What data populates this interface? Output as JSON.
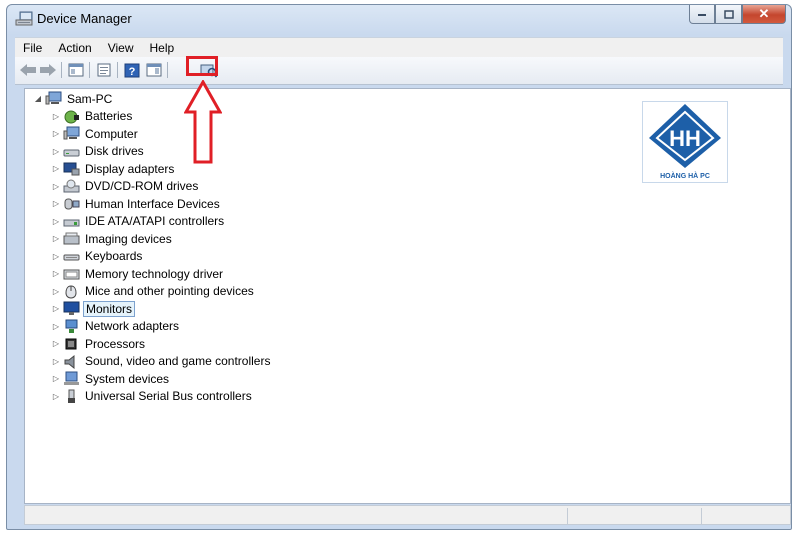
{
  "window": {
    "title": "Device Manager"
  },
  "controls": {
    "minimize": "–",
    "maximize": "□",
    "close": "✕"
  },
  "menu": [
    {
      "label": "File"
    },
    {
      "label": "Action"
    },
    {
      "label": "View"
    },
    {
      "label": "Help"
    }
  ],
  "tree": {
    "root": "Sam-PC",
    "root_expander": "◢",
    "items": [
      {
        "label": "Batteries",
        "icon": "battery-icon"
      },
      {
        "label": "Computer",
        "icon": "computer-icon"
      },
      {
        "label": "Disk drives",
        "icon": "disk-drive-icon"
      },
      {
        "label": "Display adapters",
        "icon": "display-adapter-icon"
      },
      {
        "label": "DVD/CD-ROM drives",
        "icon": "dvd-drive-icon"
      },
      {
        "label": "Human Interface Devices",
        "icon": "hid-icon"
      },
      {
        "label": "IDE ATA/ATAPI controllers",
        "icon": "ide-controller-icon"
      },
      {
        "label": "Imaging devices",
        "icon": "imaging-device-icon"
      },
      {
        "label": "Keyboards",
        "icon": "keyboard-icon"
      },
      {
        "label": "Memory technology driver",
        "icon": "memory-driver-icon"
      },
      {
        "label": "Mice and other pointing devices",
        "icon": "mouse-icon"
      },
      {
        "label": "Monitors",
        "icon": "monitor-icon",
        "selected": true
      },
      {
        "label": "Network adapters",
        "icon": "network-adapter-icon"
      },
      {
        "label": "Processors",
        "icon": "processor-icon"
      },
      {
        "label": "Sound, video and game controllers",
        "icon": "sound-icon"
      },
      {
        "label": "System devices",
        "icon": "system-device-icon"
      },
      {
        "label": "Universal Serial Bus controllers",
        "icon": "usb-icon"
      }
    ],
    "collapsed_expander": "▷"
  },
  "watermark": {
    "logo_letters": "HH",
    "text": "HOÀNG HÀ PC"
  },
  "colors": {
    "selection_bg": "#e5f3fb",
    "highlight_red": "#e01f26",
    "logo_blue": "#1d5fa8"
  }
}
